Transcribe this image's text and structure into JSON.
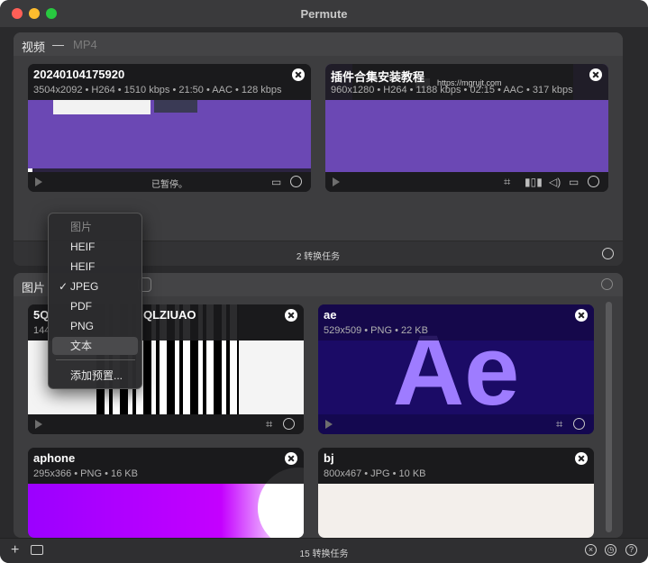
{
  "window": {
    "title": "Permute"
  },
  "video_panel": {
    "title": "视频",
    "dash": "—",
    "format": "MP4",
    "footer": "2 转换任务",
    "cards": [
      {
        "title": "20240104175920",
        "meta": "3504x2092 • H264 • 1510 kbps • 21:50 • AAC • 128 kbps",
        "status": "已暂停。",
        "progress": 0.015
      },
      {
        "title": "插件合集安装教程",
        "meta": "960x1280 • H264 • 1188 kbps • 02:15 • AAC • 317 kbps",
        "url_text": "https://mgrujt.com"
      }
    ]
  },
  "image_panel": {
    "title": "图片",
    "cards": [
      {
        "title": "5Q",
        "title_tail": "QLZIUAO",
        "meta": "144"
      },
      {
        "title": "ae",
        "meta": "529x509 • PNG • 22 KB",
        "logo_text": "Ae"
      },
      {
        "title": "aphone",
        "meta": "295x366 • PNG • 16 KB"
      },
      {
        "title": "bj",
        "meta": "800x467 • JPG • 10 KB"
      }
    ]
  },
  "menu": {
    "header": "图片",
    "items": [
      "HEIF",
      "HEIF",
      "JPEG",
      "PDF",
      "PNG",
      "文本"
    ],
    "checked": "JPEG",
    "highlighted": "文本",
    "add_preset": "添加预置..."
  },
  "bottom_bar": {
    "status": "15 转换任务"
  },
  "colors": {
    "purple": "#6f4ab8",
    "ae_bg": "#1b0b66",
    "ae_text": "#9e7cff",
    "magenta": "#b300ff"
  }
}
